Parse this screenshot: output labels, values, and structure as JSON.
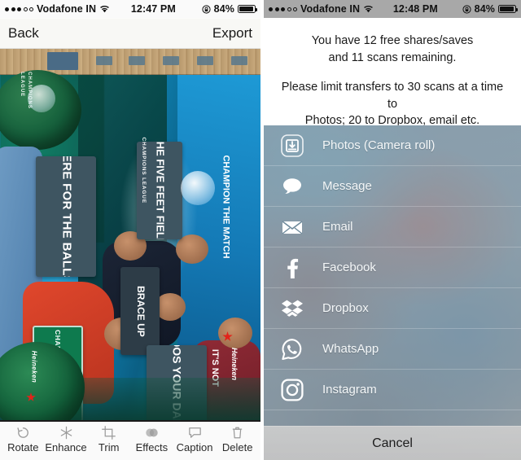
{
  "left": {
    "status_bar": {
      "signal_dots_filled": 3,
      "signal_dots_total": 5,
      "carrier": "Vodafone IN",
      "wifi_icon": "wifi-icon",
      "time": "12:47 PM",
      "rotation_lock_icon": "rotation-lock-icon",
      "battery_percent": "84%",
      "battery_level": 84
    },
    "navbar": {
      "back_label": "Back",
      "export_label": "Export"
    },
    "photo": {
      "description": "Group photo rotated sideways at a UEFA Champions League / Heineken event",
      "sign_texts": [
        "HERE FOR THE BALLS!",
        "THE FIVE FEET FIELD",
        "BRACE UP",
        "FOOS YOUR DADDY",
        "IT'S NOT",
        "CHAMPION THE MATCH",
        "CHAMPION THE MATCH"
      ],
      "brand_texts": [
        "CHAMPIONS LEAGUE",
        "Heineken"
      ]
    },
    "toolbar": [
      {
        "label": "Rotate",
        "icon": "rotate-icon"
      },
      {
        "label": "Enhance",
        "icon": "sparkle-icon"
      },
      {
        "label": "Trim",
        "icon": "crop-icon"
      },
      {
        "label": "Effects",
        "icon": "effects-circles-icon"
      },
      {
        "label": "Caption",
        "icon": "speech-bubble-icon"
      },
      {
        "label": "Delete",
        "icon": "trash-icon"
      }
    ]
  },
  "right": {
    "status_bar": {
      "signal_dots_filled": 3,
      "signal_dots_total": 5,
      "carrier": "Vodafone IN",
      "wifi_icon": "wifi-icon",
      "time": "12:48 PM",
      "rotation_lock_icon": "rotation-lock-icon",
      "battery_percent": "84%",
      "battery_level": 84
    },
    "message": {
      "line1": "You have 12 free shares/saves",
      "line2": "and 11 scans remaining.",
      "line3": "Please limit transfers to 30 scans at a time to",
      "line4": "Photos; 20 to Dropbox, email etc."
    },
    "share_options": [
      {
        "label": "Photos (Camera roll)",
        "icon": "save-to-photos-icon"
      },
      {
        "label": "Message",
        "icon": "message-bubble-icon"
      },
      {
        "label": "Email",
        "icon": "envelope-icon"
      },
      {
        "label": "Facebook",
        "icon": "facebook-icon"
      },
      {
        "label": "Dropbox",
        "icon": "dropbox-icon"
      },
      {
        "label": "WhatsApp",
        "icon": "whatsapp-icon"
      },
      {
        "label": "Instagram",
        "icon": "instagram-icon"
      }
    ],
    "cancel_label": "Cancel"
  },
  "colors": {
    "status_bar_gray": "#a8a8a8",
    "navbar": "#f8f7f4",
    "toolbar_text": "#2a2a2a",
    "sheet_text": "#f4f7f8",
    "cancel_bg": "#c9c9c9"
  }
}
